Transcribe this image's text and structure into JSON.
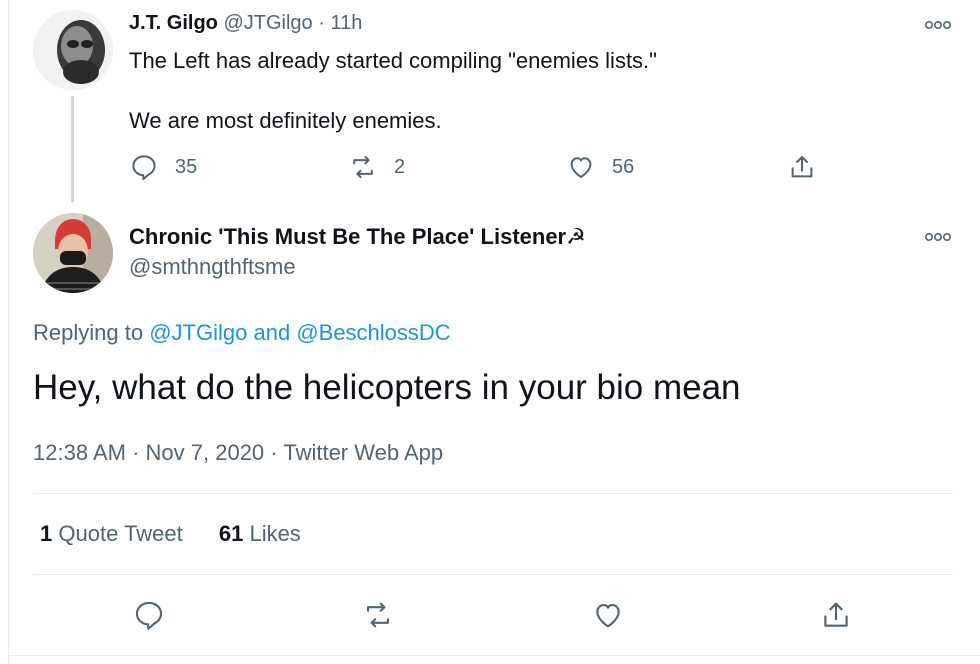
{
  "parent_tweet": {
    "display_name": "J.T. Gilgo",
    "handle": "@JTGilgo",
    "separator": "·",
    "time": "11h",
    "text_line1": "The Left has already started compiling \"enemies lists.\"",
    "text_line2": "We are most definitely enemies.",
    "reply_count": "35",
    "retweet_count": "2",
    "like_count": "56"
  },
  "main_tweet": {
    "display_name": "Chronic 'This Must Be The Place' Listener☭",
    "handle": "@smthngthftsme",
    "replying_prefix": "Replying to",
    "replying_user1": "@JTGilgo",
    "replying_and": "and",
    "replying_user2": "@BeschlossDC",
    "text": "Hey, what do the helicopters in your bio mean",
    "time": "12:38 AM",
    "separator": "·",
    "date": "Nov 7, 2020",
    "source": "Twitter Web App",
    "quote_count": "1",
    "quote_label": "Quote Tweet",
    "likes_count": "61",
    "likes_label": "Likes"
  },
  "icons": {
    "reply": "reply-icon",
    "retweet": "retweet-icon",
    "like": "heart-icon",
    "share": "share-icon",
    "more": "more-icon"
  },
  "colors": {
    "text": "#0f1419",
    "muted": "#536471",
    "link": "#1b95e0",
    "divider": "#e6ecf0"
  }
}
